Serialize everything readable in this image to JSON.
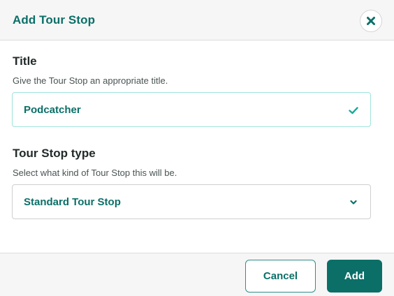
{
  "dialog": {
    "title": "Add Tour Stop",
    "close_icon": "close-icon"
  },
  "fields": {
    "title": {
      "label": "Title",
      "help": "Give the Tour Stop an appropriate title.",
      "value": "Podcatcher",
      "status_icon": "check-icon"
    },
    "type": {
      "label": "Tour Stop type",
      "help": "Select what kind of Tour Stop this will be.",
      "selected": "Standard Tour Stop",
      "dropdown_icon": "chevron-down-icon"
    }
  },
  "footer": {
    "cancel_label": "Cancel",
    "add_label": "Add"
  },
  "colors": {
    "accent": "#0b6f68",
    "valid_border": "#9fe3dc",
    "check": "#1aa99b"
  }
}
